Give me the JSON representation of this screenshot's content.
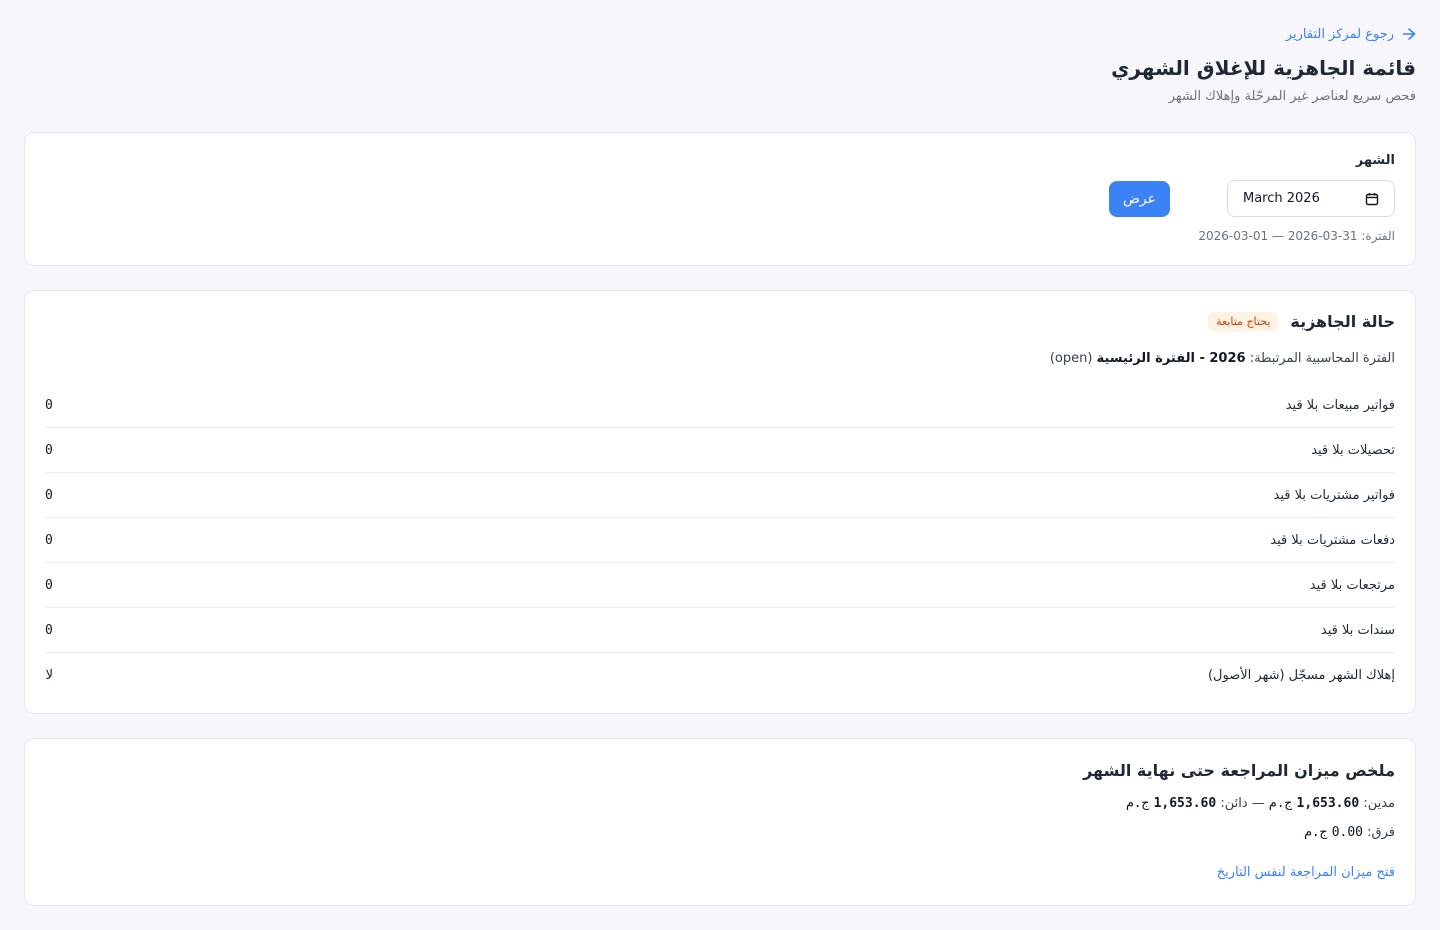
{
  "back_link": {
    "label": "رجوع لمركز التقارير",
    "icon": "arrow-right-icon"
  },
  "page": {
    "title": "قائمة الجاهزية للإغلاق الشهري",
    "subtitle": "فحص سريع لعناصر غير المرحّلة وإهلاك الشهر"
  },
  "filter": {
    "month_label": "الشهر",
    "month_value": "March 2026",
    "calendar_icon": "calendar-icon",
    "show_button": "عرض",
    "period_prefix": "الفترة:",
    "period_start": "2026-03-01",
    "period_separator": "—",
    "period_end": "2026-03-31"
  },
  "readiness": {
    "title": "حالة الجاهزية",
    "badge": "يحتاج متابعة",
    "badge_color": "#c2410c",
    "linked_prefix": "الفترة المحاسبية المرتبطة:",
    "linked_name": "2026 - الفترة الرئيسية",
    "linked_status": "(open)",
    "checks": [
      {
        "label": "فواتير مبيعات بلا قيد",
        "value": "0"
      },
      {
        "label": "تحصيلات بلا قيد",
        "value": "0"
      },
      {
        "label": "فواتير مشتريات بلا قيد",
        "value": "0"
      },
      {
        "label": "دفعات مشتريات بلا قيد",
        "value": "0"
      },
      {
        "label": "مرتجعات بلا قيد",
        "value": "0"
      },
      {
        "label": "سندات بلا قيد",
        "value": "0"
      },
      {
        "label": "إهلاك الشهر مسجّل (شهر الأصول)",
        "value": "لا"
      }
    ]
  },
  "trial_balance": {
    "title": "ملخص ميزان المراجعة حتى نهاية الشهر",
    "debit_label": "مدين:",
    "debit_value": "1,653.60",
    "currency": "ج.م",
    "separator": "—",
    "credit_label": "دائن:",
    "credit_value": "1,653.60",
    "diff_label": "فرق:",
    "diff_value": "0.00",
    "open_link": "فتح ميزان المراجعة لنفس التاريخ"
  },
  "colors": {
    "accent": "#3b82f6",
    "background": "#f7f7fb",
    "card": "#ffffff"
  }
}
